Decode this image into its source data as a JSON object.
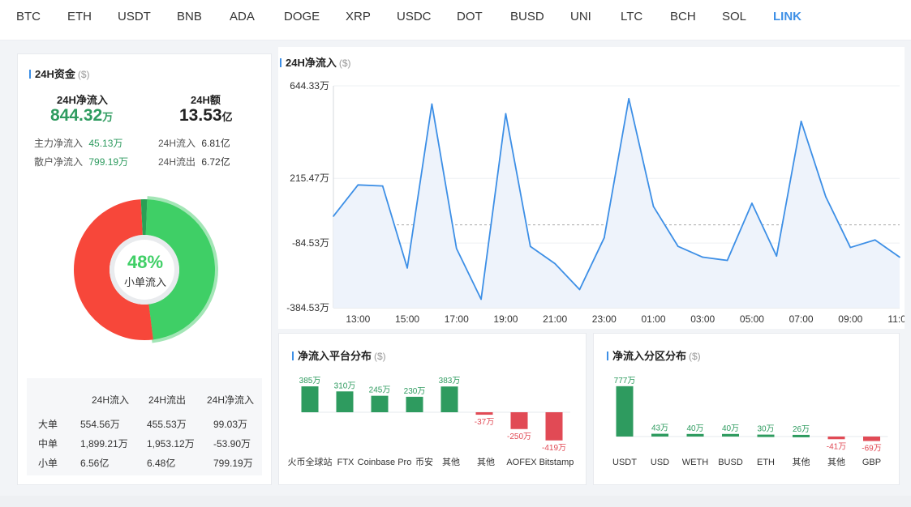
{
  "tabs": [
    "BTC",
    "ETH",
    "USDT",
    "BNB",
    "ADA",
    "DOGE",
    "XRP",
    "USDC",
    "DOT",
    "BUSD",
    "UNI",
    "LTC",
    "BCH",
    "SOL",
    "LINK"
  ],
  "active_tab": "LINK",
  "funds": {
    "title": "24H资金",
    "unit": "($)",
    "net_label": "24H净流入",
    "net_value": "844.32",
    "net_unit": "万",
    "vol_label": "24H额",
    "vol_value": "13.53",
    "vol_unit": "亿",
    "main_label": "主力净流入",
    "main_value": "45.13万",
    "retail_label": "散户净流入",
    "retail_value": "799.19万",
    "in_label": "24H流入",
    "in_value": "6.81亿",
    "out_label": "24H流出",
    "out_value": "6.72亿",
    "donut_percent": "48%",
    "donut_label": "小单流入",
    "donut_fraction": 0.48,
    "table": {
      "headers": [
        "24H流入",
        "24H流出",
        "24H净流入"
      ],
      "rows": [
        {
          "name": "大单",
          "in": "554.56万",
          "out": "455.53万",
          "net": "99.03万",
          "sign": "pos"
        },
        {
          "name": "中单",
          "in": "1,899.21万",
          "out": "1,953.12万",
          "net": "-53.90万",
          "sign": "neg"
        },
        {
          "name": "小单",
          "in": "6.56亿",
          "out": "6.48亿",
          "net": "799.19万",
          "sign": "pos"
        }
      ]
    }
  },
  "line_title": "24H净流入",
  "line_unit": "($)",
  "platform_title": "净流入平台分布",
  "platform_unit": "($)",
  "region_title": "净流入分区分布",
  "region_unit": "($)",
  "colors": {
    "accent": "#3d8fe6",
    "green": "#2e9b5f",
    "red": "#e14a55",
    "donut_green": "#3fcf66",
    "donut_red": "#f7473a"
  },
  "chart_data": [
    {
      "type": "line",
      "title": "24H净流入",
      "ylim": [
        -384.53,
        644.33
      ],
      "y_ticks": [
        "644.33万",
        "215.47万",
        "-84.53万",
        "-384.53万"
      ],
      "y_tick_values": [
        644.33,
        215.47,
        -84.53,
        -384.53
      ],
      "x_ticks": [
        "13:00",
        "15:00",
        "17:00",
        "19:00",
        "21:00",
        "23:00",
        "01:00",
        "03:00",
        "05:00",
        "07:00",
        "09:00",
        "11:00"
      ],
      "x": [
        "12:00",
        "12:30",
        "13:00",
        "13:30",
        "14:00",
        "14:30",
        "15:00",
        "15:30",
        "16:00",
        "16:30",
        "17:00",
        "17:30",
        "18:00",
        "18:30",
        "19:00",
        "19:30",
        "20:00",
        "20:30",
        "21:00",
        "21:30",
        "22:00",
        "22:30",
        "23:00",
        "23:30",
        "00:00",
        "00:30",
        "01:00",
        "01:30",
        "02:00",
        "02:30",
        "03:00",
        "03:30",
        "04:00",
        "04:30",
        "05:00",
        "05:30",
        "06:00",
        "06:30",
        "07:00",
        "07:30",
        "08:00",
        "08:30",
        "09:00",
        "09:30",
        "10:00",
        "10:30",
        "11:00",
        "11:30",
        "12:00",
        "12:30",
        "13:00",
        "13:30",
        "14:00",
        "14:30",
        "15:00",
        "15:30",
        "16:00",
        "16:30",
        "17:00",
        "17:30",
        "18:00",
        "18:30",
        "19:00",
        "19:30",
        "20:00",
        "20:30",
        "21:00",
        "21:30",
        "22:00",
        "22:30",
        "23:00",
        "23:30",
        "00:00"
      ],
      "points": [
        {
          "t": 12.0,
          "v": 40
        },
        {
          "t": 13.0,
          "v": 185
        },
        {
          "t": 14.0,
          "v": 180
        },
        {
          "t": 15.0,
          "v": -200
        },
        {
          "t": 16.0,
          "v": 560
        },
        {
          "t": 17.0,
          "v": -110
        },
        {
          "t": 18.0,
          "v": -345
        },
        {
          "t": 19.0,
          "v": 515
        },
        {
          "t": 20.0,
          "v": -100
        },
        {
          "t": 21.0,
          "v": -180
        },
        {
          "t": 22.0,
          "v": -300
        },
        {
          "t": 23.0,
          "v": -60
        },
        {
          "t": 24.0,
          "v": 585
        },
        {
          "t": 25.0,
          "v": 85
        },
        {
          "t": 26.0,
          "v": -100
        },
        {
          "t": 27.0,
          "v": -150
        },
        {
          "t": 28.0,
          "v": -165
        },
        {
          "t": 29.0,
          "v": 100
        },
        {
          "t": 30.0,
          "v": -145
        },
        {
          "t": 31.0,
          "v": 480
        },
        {
          "t": 32.0,
          "v": 130
        },
        {
          "t": 33.0,
          "v": -105
        },
        {
          "t": 34.0,
          "v": -70
        },
        {
          "t": 35.0,
          "v": -150
        }
      ],
      "baseline": 0,
      "grid": true
    },
    {
      "type": "bar",
      "title": "净流入平台分布",
      "categories": [
        "火币全球站",
        "FTX",
        "Coinbase Pro",
        "币安",
        "其他",
        "其他",
        "AOFEX",
        "Bitstamp"
      ],
      "values": [
        385,
        310,
        245,
        230,
        383,
        -37,
        -250,
        -419
      ],
      "labels": [
        "385万",
        "310万",
        "245万",
        "230万",
        "383万",
        "-37万",
        "-250万",
        "-419万"
      ]
    },
    {
      "type": "bar",
      "title": "净流入分区分布",
      "categories": [
        "USDT",
        "USD",
        "WETH",
        "BUSD",
        "ETH",
        "其他",
        "其他",
        "GBP"
      ],
      "values": [
        777,
        43,
        40,
        40,
        30,
        26,
        -41,
        -69
      ],
      "labels": [
        "777万",
        "43万",
        "40万",
        "40万",
        "30万",
        "26万",
        "-41万",
        "-69万"
      ]
    }
  ]
}
